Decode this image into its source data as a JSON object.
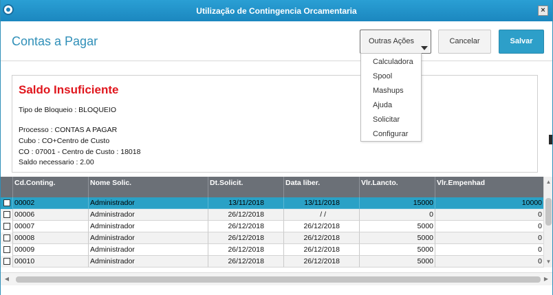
{
  "window": {
    "title": "Utilização de Contingencia Orcamentaria",
    "close_glyph": "×"
  },
  "header": {
    "title": "Contas a Pagar",
    "outras_acoes_label": "Outras Ações",
    "cancel_label": "Cancelar",
    "save_label": "Salvar"
  },
  "menu": {
    "items": [
      "Calculadora",
      "Spool",
      "Mashups",
      "Ajuda",
      "Solicitar",
      "Configurar"
    ]
  },
  "message": {
    "title": "Saldo Insuficiente",
    "bloqueio": "Tipo de Bloqueio : BLOQUEIO",
    "processo": "Processo : CONTAS A PAGAR",
    "cubo": "Cubo : CO+Centro de Custo",
    "co": "CO : 07001 - Centro de Custo : 18018",
    "saldo": "Saldo necessario : 2.00"
  },
  "grid": {
    "columns": [
      "Cd.Conting.",
      "Nome Solic.",
      "Dt.Solicit.",
      "Data liber.",
      "Vlr.Lancto.",
      "Vlr.Empenhad"
    ],
    "rows": [
      {
        "codigo": "00002",
        "nome": "Administrador",
        "dt_solicit": "13/11/2018",
        "data_liber": "13/11/2018",
        "vlr_lancto": "15000",
        "vlr_empenhad": "10000"
      },
      {
        "codigo": "00006",
        "nome": "Administrador",
        "dt_solicit": "26/12/2018",
        "data_liber": "/ /",
        "vlr_lancto": "0",
        "vlr_empenhad": "0"
      },
      {
        "codigo": "00007",
        "nome": "Administrador",
        "dt_solicit": "26/12/2018",
        "data_liber": "26/12/2018",
        "vlr_lancto": "5000",
        "vlr_empenhad": "0"
      },
      {
        "codigo": "00008",
        "nome": "Administrador",
        "dt_solicit": "26/12/2018",
        "data_liber": "26/12/2018",
        "vlr_lancto": "5000",
        "vlr_empenhad": "0"
      },
      {
        "codigo": "00009",
        "nome": "Administrador",
        "dt_solicit": "26/12/2018",
        "data_liber": "26/12/2018",
        "vlr_lancto": "5000",
        "vlr_empenhad": "0"
      },
      {
        "codigo": "00010",
        "nome": "Administrador",
        "dt_solicit": "26/12/2018",
        "data_liber": "26/12/2018",
        "vlr_lancto": "5000",
        "vlr_empenhad": "0"
      }
    ],
    "selected_row": 0
  },
  "colors": {
    "titlebar": "#1b87bf",
    "accent": "#2f8fb8",
    "save_button": "#2d9fc9",
    "error_title": "#e0161d",
    "grid_header": "#6b7077",
    "selected_row": "#2aa1c6"
  },
  "icons": {
    "app": "app-logo-icon",
    "close": "close-icon",
    "dropdown": "caret-down-icon",
    "scroll_up": "scroll-up-arrow-icon",
    "scroll_down": "scroll-down-arrow-icon",
    "scroll_left": "scroll-left-arrow-icon",
    "scroll_right": "scroll-right-arrow-icon"
  },
  "scroll_glyphs": {
    "up": "▲",
    "down": "▼",
    "left": "◀",
    "right": "▶"
  }
}
